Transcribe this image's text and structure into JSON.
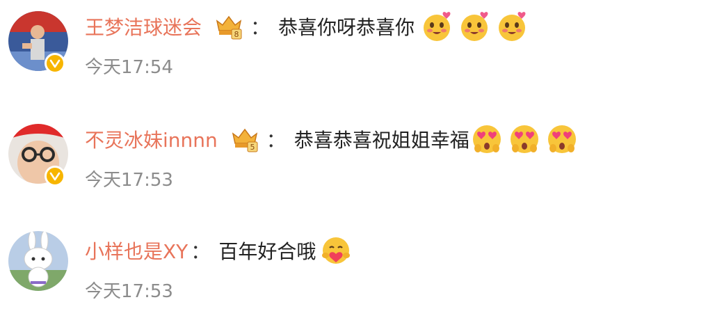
{
  "comments": [
    {
      "username": "王梦洁球迷会",
      "badge_icon": "crown-rank-badge-8",
      "colon": "：",
      "text": "恭喜你呀恭喜你",
      "emoji_icons": [
        "blush-heart-emoji",
        "blush-heart-emoji",
        "blush-heart-emoji"
      ],
      "time": "今天17:54",
      "verified_icon": "verified-v-icon"
    },
    {
      "username": "不灵冰妹innnn",
      "badge_icon": "crown-rank-badge-5",
      "colon": "：",
      "text": "恭喜恭喜祝姐姐幸福",
      "emoji_icons": [
        "heart-eyes-emoji",
        "heart-eyes-emoji",
        "heart-eyes-emoji"
      ],
      "time": "今天17:53",
      "verified_icon": "verified-v-icon"
    },
    {
      "username": "小样也是XY",
      "colon": "：",
      "text": "百年好合哦",
      "emoji_icons": [
        "hug-heart-emoji"
      ],
      "time": "今天17:53"
    }
  ],
  "colors": {
    "username": "#e8745a",
    "text": "#222222",
    "time": "#8c8c8c",
    "verified_badge": "#f7b500"
  }
}
